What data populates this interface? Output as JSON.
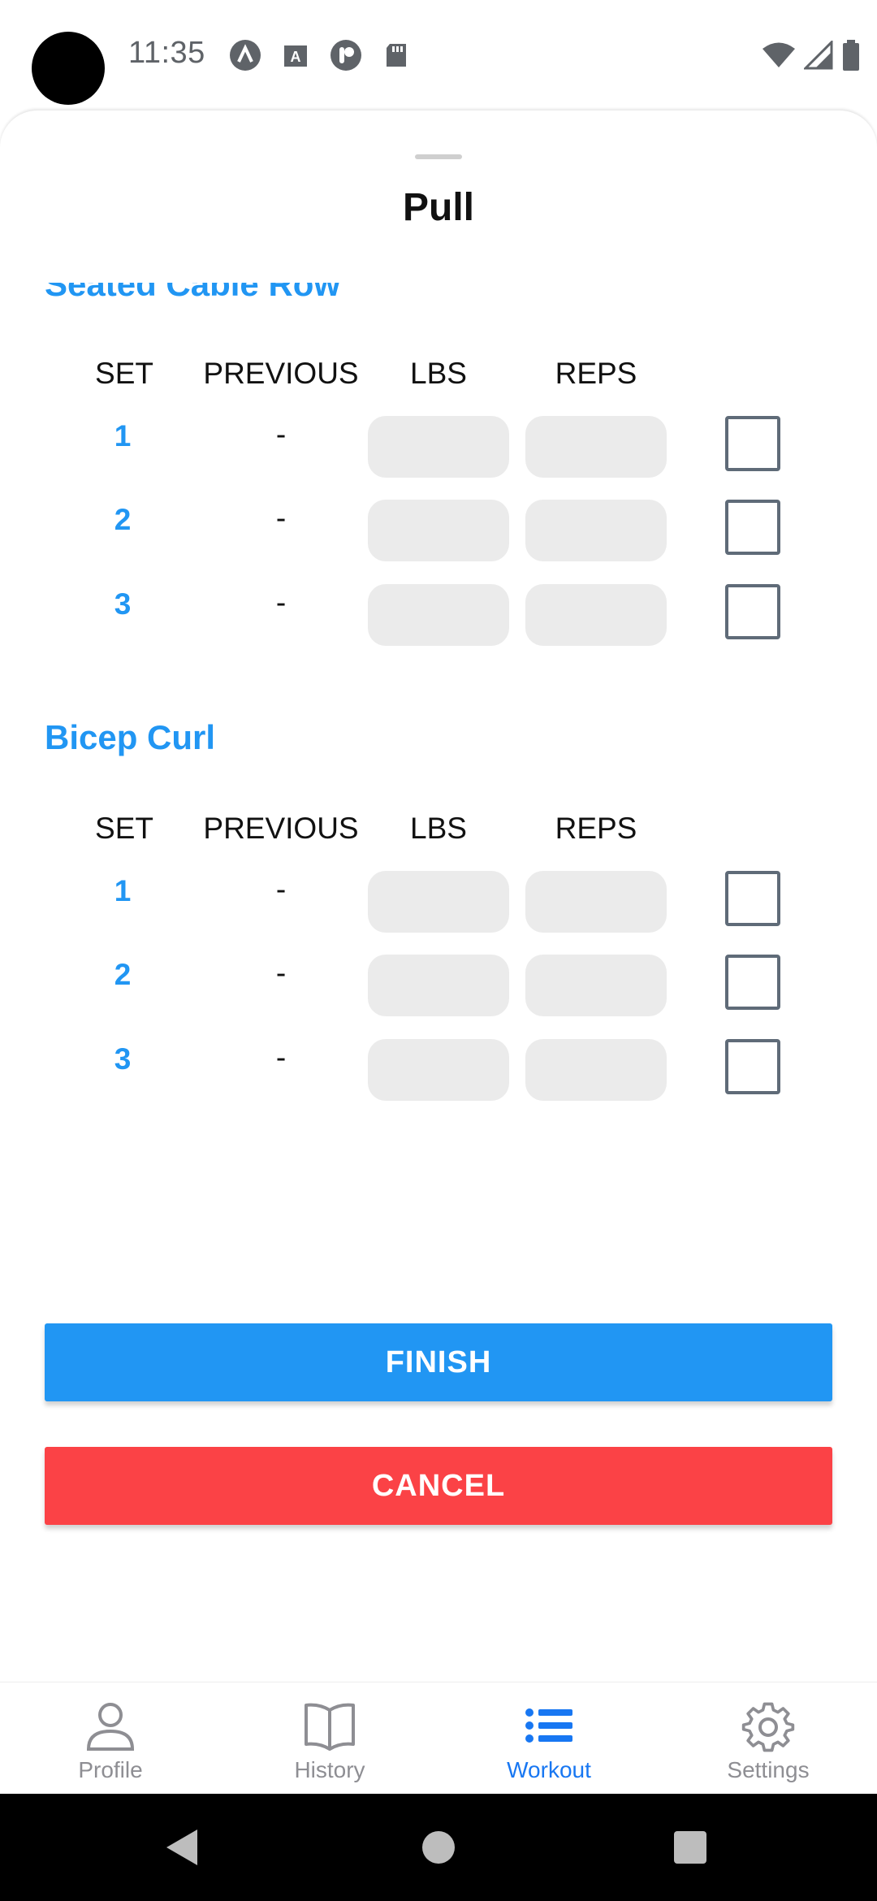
{
  "status_bar": {
    "time": "11:35",
    "left_icons": [
      "arc-icon",
      "a-square-icon",
      "p-circle-icon",
      "sd-card-icon"
    ],
    "right_icons": [
      "wifi-icon",
      "signal-icon",
      "battery-icon"
    ]
  },
  "sheet": {
    "title": "Pull"
  },
  "columns": {
    "set": "SET",
    "previous": "PREVIOUS",
    "lbs": "LBS",
    "reps": "REPS"
  },
  "exercises": [
    {
      "name": "Seated Cable Row",
      "sets": [
        {
          "num": "1",
          "previous": "-",
          "lbs": "",
          "reps": "",
          "done": false
        },
        {
          "num": "2",
          "previous": "-",
          "lbs": "",
          "reps": "",
          "done": false
        },
        {
          "num": "3",
          "previous": "-",
          "lbs": "",
          "reps": "",
          "done": false
        }
      ]
    },
    {
      "name": "Bicep Curl",
      "sets": [
        {
          "num": "1",
          "previous": "-",
          "lbs": "",
          "reps": "",
          "done": false
        },
        {
          "num": "2",
          "previous": "-",
          "lbs": "",
          "reps": "",
          "done": false
        },
        {
          "num": "3",
          "previous": "-",
          "lbs": "",
          "reps": "",
          "done": false
        }
      ]
    }
  ],
  "buttons": {
    "finish": "FINISH",
    "cancel": "CANCEL"
  },
  "tabs": [
    {
      "label": "Profile",
      "icon": "person-icon",
      "active": false
    },
    {
      "label": "History",
      "icon": "book-icon",
      "active": false
    },
    {
      "label": "Workout",
      "icon": "list-icon",
      "active": true
    },
    {
      "label": "Settings",
      "icon": "gear-icon",
      "active": false
    }
  ],
  "colors": {
    "accent": "#2196f3",
    "danger": "#fb4246",
    "active_tab": "#1877f2",
    "field_bg": "#ebebeb"
  }
}
